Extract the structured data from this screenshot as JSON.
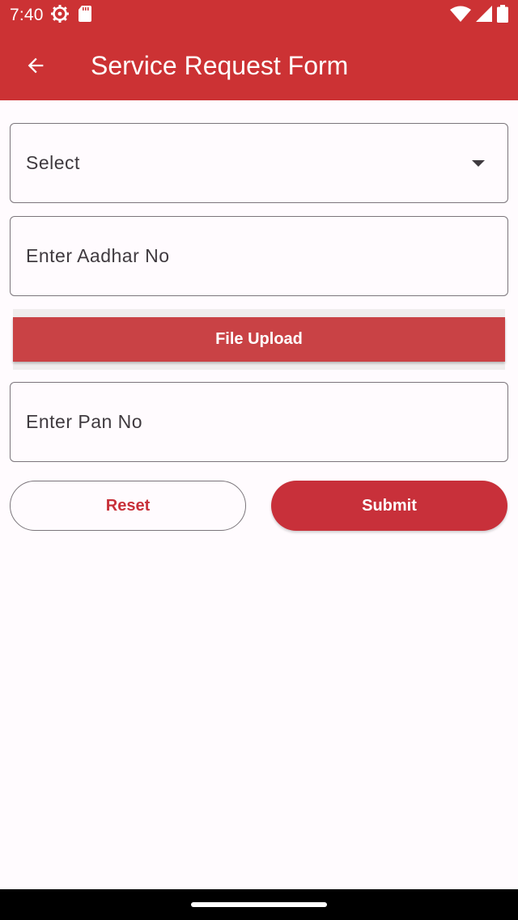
{
  "status_bar": {
    "time": "7:40",
    "icons": [
      "settings-gear-icon",
      "sd-card-icon",
      "wifi-icon",
      "signal-icon",
      "battery-icon"
    ]
  },
  "app_bar": {
    "title": "Service Request Form",
    "back_icon": "arrow-back-icon",
    "color": "#cc3234"
  },
  "form": {
    "select": {
      "label": "Select",
      "icon": "caret-down-icon"
    },
    "aadhar": {
      "placeholder": "Enter Aadhar No",
      "value": ""
    },
    "file_upload_label": "File Upload",
    "pan": {
      "placeholder": "Enter Pan No",
      "value": ""
    }
  },
  "actions": {
    "reset_label": "Reset",
    "submit_label": "Submit",
    "accent": "#c8303a"
  }
}
